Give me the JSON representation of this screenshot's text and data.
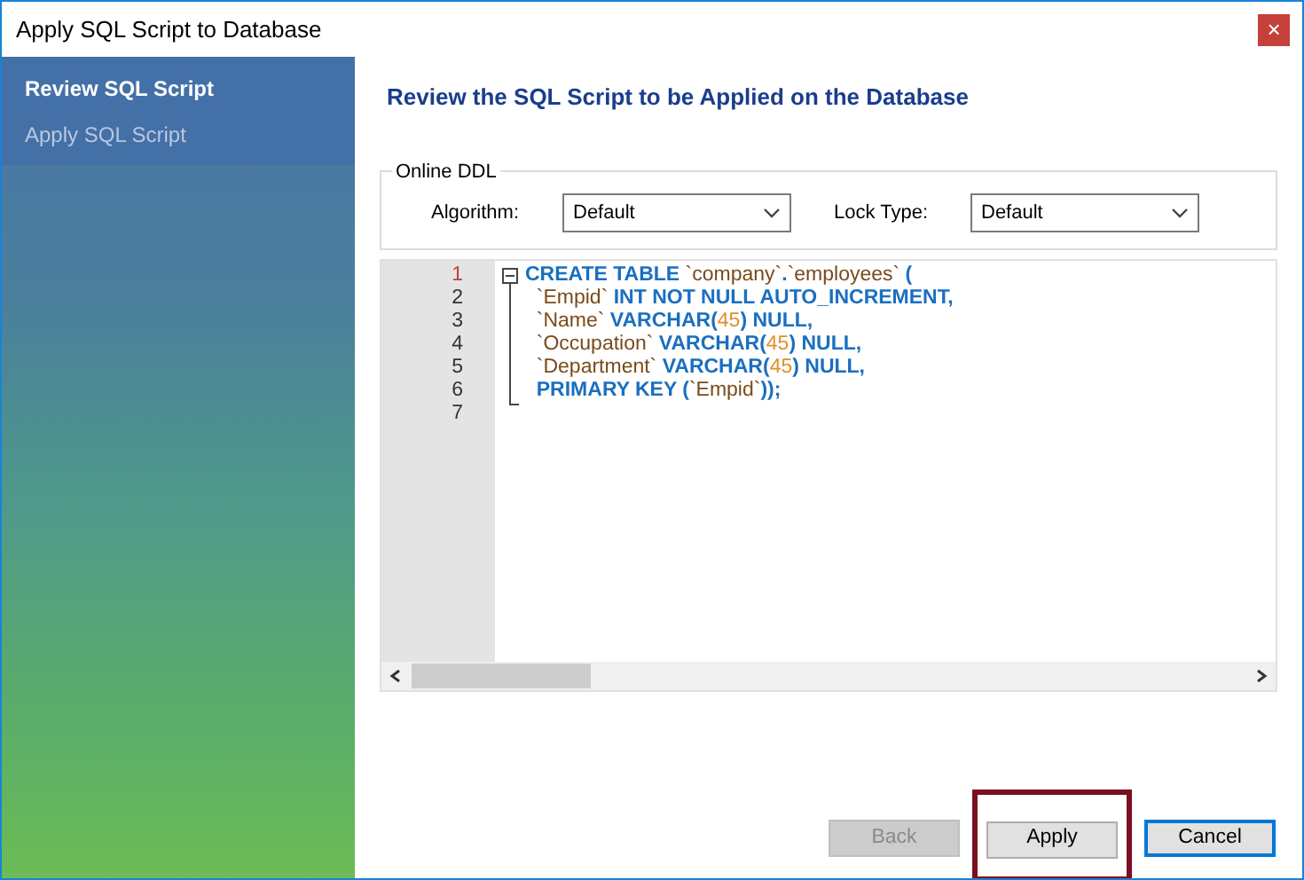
{
  "window": {
    "title": "Apply SQL Script to Database",
    "close_glyph": "×"
  },
  "sidebar": {
    "items": [
      {
        "label": "Review SQL Script",
        "selected": true
      },
      {
        "label": "Apply SQL Script",
        "selected": false
      }
    ]
  },
  "heading": "Review the SQL Script to be Applied on the Database",
  "online_ddl": {
    "title": "Online DDL",
    "fields": [
      {
        "label": "Algorithm:",
        "value": "Default"
      },
      {
        "label": "Lock Type:",
        "value": "Default"
      }
    ]
  },
  "editor": {
    "lines": [
      {
        "number": "1",
        "tokens": [
          {
            "kind": "keyword",
            "text": "CREATE TABLE "
          },
          {
            "kind": "identifier",
            "text": "`company`"
          },
          {
            "kind": "keyword",
            "text": "."
          },
          {
            "kind": "identifier",
            "text": "`employees`"
          },
          {
            "kind": "keyword",
            "text": " ("
          }
        ]
      },
      {
        "number": "2",
        "tokens": [
          {
            "kind": "identifier",
            "text": "  `Empid` "
          },
          {
            "kind": "keyword",
            "text": "INT NOT NULL AUTO_INCREMENT,"
          }
        ]
      },
      {
        "number": "3",
        "tokens": [
          {
            "kind": "identifier",
            "text": "  `Name` "
          },
          {
            "kind": "keyword",
            "text": "VARCHAR("
          },
          {
            "kind": "number",
            "text": "45"
          },
          {
            "kind": "keyword",
            "text": ") NULL,"
          }
        ]
      },
      {
        "number": "4",
        "tokens": [
          {
            "kind": "identifier",
            "text": "  `Occupation` "
          },
          {
            "kind": "keyword",
            "text": "VARCHAR("
          },
          {
            "kind": "number",
            "text": "45"
          },
          {
            "kind": "keyword",
            "text": ") NULL,"
          }
        ]
      },
      {
        "number": "5",
        "tokens": [
          {
            "kind": "identifier",
            "text": "  `Department` "
          },
          {
            "kind": "keyword",
            "text": "VARCHAR("
          },
          {
            "kind": "number",
            "text": "45"
          },
          {
            "kind": "keyword",
            "text": ") NULL,"
          }
        ]
      },
      {
        "number": "6",
        "tokens": [
          {
            "kind": "keyword",
            "text": "  PRIMARY KEY ("
          },
          {
            "kind": "identifier",
            "text": "`Empid`"
          },
          {
            "kind": "keyword",
            "text": "));"
          }
        ]
      },
      {
        "number": "7"
      }
    ]
  },
  "buttons": [
    {
      "label": "Back",
      "disabled": true,
      "default": false,
      "highlighted": false
    },
    {
      "label": "Apply",
      "disabled": false,
      "default": false,
      "highlighted": true
    },
    {
      "label": "Cancel",
      "disabled": false,
      "default": true,
      "highlighted": false
    }
  ]
}
